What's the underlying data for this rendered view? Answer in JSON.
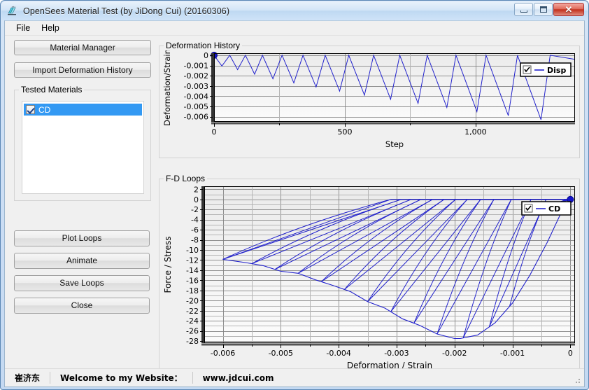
{
  "window": {
    "title": "OpenSees Material Test (by JiDong Cui) (20160306)",
    "app_icon": "opensees-icon",
    "buttons": {
      "minimize": "minimize-button",
      "maximize": "maximize-button",
      "close": "close-button"
    }
  },
  "menu": {
    "items": [
      {
        "label": "File"
      },
      {
        "label": "Help"
      }
    ]
  },
  "sidebar": {
    "top_buttons": [
      {
        "label": "Material Manager",
        "name": "material-manager-button"
      },
      {
        "label": "Import Deformation History",
        "name": "import-deformation-history-button"
      }
    ],
    "group": {
      "title": "Tested Materials",
      "items": [
        {
          "label": "CD",
          "checked": true,
          "selected": true
        }
      ]
    },
    "bottom_buttons": [
      {
        "label": "Plot Loops",
        "name": "plot-loops-button"
      },
      {
        "label": "Animate",
        "name": "animate-button"
      },
      {
        "label": "Save Loops",
        "name": "save-loops-button"
      },
      {
        "label": "Close",
        "name": "close-dialog-button"
      }
    ]
  },
  "panels": {
    "deformation_history": {
      "title": "Deformation History"
    },
    "fd_loops": {
      "title": "F-D Loops"
    }
  },
  "statusbar": {
    "author": "崔济东",
    "welcome": "Welcome to my Website：",
    "website": "www.jdcui.com"
  },
  "colors": {
    "series": "#2222cc",
    "marker": "#1414c8",
    "selection": "#3399f3",
    "plot_bg_top": "#ebebeb",
    "plot_bg_bottom": "#fbfbfb",
    "grid": "#808080",
    "axis": "#000000"
  },
  "chart_data": [
    {
      "id": "deformation-history",
      "type": "line",
      "title": "Deformation History",
      "xlabel": "Step",
      "ylabel": "Deformation/Strain",
      "xlim": [
        0,
        1380
      ],
      "ylim": [
        -0.0065,
        0.0002
      ],
      "xticks": [
        0,
        500,
        1000
      ],
      "xticklabels": [
        "0",
        "500",
        "1,000"
      ],
      "yticks": [
        0,
        -0.001,
        -0.002,
        -0.003,
        -0.004,
        -0.005,
        -0.006
      ],
      "yticklabels": [
        "0",
        "-0.001",
        "-0.002",
        "-0.003",
        "-0.004",
        "-0.005",
        "-0.006"
      ],
      "grid": true,
      "legend": {
        "position": "top-right",
        "entries": [
          {
            "label": "Disp",
            "checked": true,
            "color": "#2222cc"
          }
        ]
      },
      "markers": [
        {
          "x": 0,
          "y": 0,
          "label": "start-point"
        }
      ],
      "series": [
        {
          "name": "Disp",
          "comment": "triangular cyclic loading, amplitude grows each cycle, returns to 0 at each peak",
          "x": [
            0,
            30,
            60,
            90,
            120,
            155,
            185,
            225,
            260,
            305,
            340,
            390,
            425,
            480,
            515,
            575,
            610,
            675,
            710,
            780,
            815,
            890,
            925,
            1005,
            1040,
            1125,
            1160,
            1250,
            1285,
            1380
          ],
          "y": [
            0,
            -0.00105,
            0,
            -0.0014,
            0,
            -0.00185,
            0,
            -0.0023,
            0,
            -0.0027,
            0,
            -0.0031,
            0,
            -0.0035,
            0,
            -0.0039,
            0,
            -0.0043,
            0,
            -0.0047,
            0,
            -0.0051,
            0,
            -0.0055,
            0,
            -0.0059,
            0,
            -0.0063,
            0,
            -0.0004
          ]
        }
      ]
    },
    {
      "id": "fd-loops",
      "type": "line",
      "title": "F-D Loops",
      "xlabel": "Deformation / Strain",
      "ylabel": "Force / Stress",
      "xlim": [
        -0.00632,
        8e-05
      ],
      "ylim": [
        -28.4,
        2.6
      ],
      "xticks": [
        -0.006,
        -0.005,
        -0.004,
        -0.003,
        -0.002,
        -0.001,
        0
      ],
      "xticklabels": [
        "-0.006",
        "-0.005",
        "-0.004",
        "-0.003",
        "-0.002",
        "-0.001",
        "0"
      ],
      "yticks": [
        2,
        0,
        -2,
        -4,
        -6,
        -8,
        -10,
        -12,
        -14,
        -16,
        -18,
        -20,
        -22,
        -24,
        -26,
        -28
      ],
      "yticklabels": [
        "2",
        "0",
        "-2",
        "-4",
        "-6",
        "-8",
        "-10",
        "-12",
        "-14",
        "-16",
        "-18",
        "-20",
        "-22",
        "-24",
        "-26",
        "-28"
      ],
      "grid": true,
      "legend": {
        "position": "top-right",
        "entries": [
          {
            "label": "CD",
            "checked": true,
            "color": "#2222cc"
          }
        ]
      },
      "markers": [
        {
          "x": 0,
          "y": 0,
          "label": "end-point"
        }
      ],
      "series": [
        {
          "name": "CD",
          "comment": "concrete hysteresis: monotonic compression envelope peaking ~-27.5 at strain -0.002 then softening to ~-11.8 at -0.006; each cycle unloads linearly back to zero force then reloads along a line to the envelope.",
          "envelope_x": [
            0,
            -0.00015,
            -0.0004,
            -0.0007,
            -0.001,
            -0.0013,
            -0.0016,
            -0.0019,
            -0.002,
            -0.0023,
            -0.0026,
            -0.0029,
            -0.0032,
            -0.0035,
            -0.0038,
            -0.0041,
            -0.0044,
            -0.0047,
            -0.005,
            -0.0053,
            -0.0056,
            -0.006
          ],
          "envelope_y": [
            0,
            -2.4,
            -8.5,
            -15.0,
            -20.5,
            -24.4,
            -26.8,
            -27.5,
            -27.5,
            -26.6,
            -24.9,
            -23.6,
            -21.5,
            -20.2,
            -18.2,
            -17.0,
            -15.9,
            -14.6,
            -14.2,
            -13.1,
            -12.5,
            -11.85
          ],
          "cycles": [
            {
              "peak_x": -0.00105,
              "peak_y": -21.2,
              "unload_to_x": -0.00042
            },
            {
              "peak_x": -0.0014,
              "peak_y": -24.6,
              "unload_to_x": -0.00068
            },
            {
              "peak_x": -0.00185,
              "peak_y": -27.3,
              "unload_to_x": -0.00102
            },
            {
              "peak_x": -0.0023,
              "peak_y": -26.6,
              "unload_to_x": -0.00132
            },
            {
              "peak_x": -0.0027,
              "peak_y": -24.2,
              "unload_to_x": -0.00155
            },
            {
              "peak_x": -0.0031,
              "peak_y": -22.2,
              "unload_to_x": -0.00178
            },
            {
              "peak_x": -0.0035,
              "peak_y": -20.2,
              "unload_to_x": -0.00198
            },
            {
              "peak_x": -0.0039,
              "peak_y": -18.1,
              "unload_to_x": -0.00218
            },
            {
              "peak_x": -0.0043,
              "peak_y": -16.1,
              "unload_to_x": -0.00238
            },
            {
              "peak_x": -0.0047,
              "peak_y": -14.3,
              "unload_to_x": -0.00258
            },
            {
              "peak_x": -0.0051,
              "peak_y": -14.1,
              "unload_to_x": -0.00275
            },
            {
              "peak_x": -0.0055,
              "peak_y": -12.6,
              "unload_to_x": -0.00292
            },
            {
              "peak_x": -0.006,
              "peak_y": -11.85,
              "unload_to_x": -0.0031
            }
          ]
        }
      ]
    }
  ]
}
